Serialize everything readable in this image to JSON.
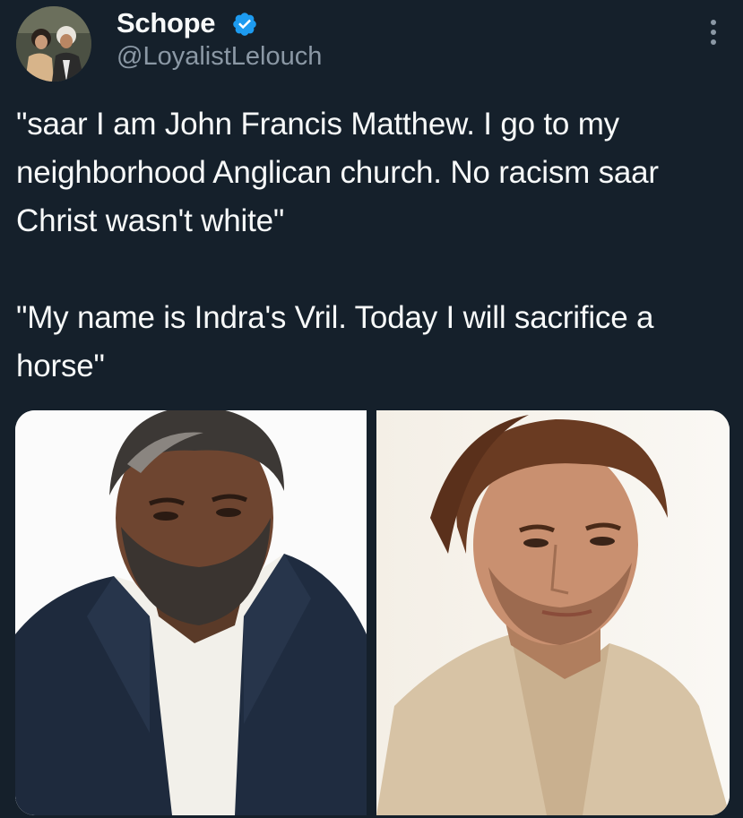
{
  "author": {
    "display_name": "Schope",
    "handle": "@LoyalistLelouch",
    "verified_icon": "verified-badge-icon",
    "avatar": "profile-avatar",
    "verified_color": "#1d9bf0"
  },
  "menu": {
    "icon": "more-options-icon"
  },
  "tweet": {
    "paragraphs": [
      "\"saar I am John Francis Matthew. I go to my neighborhood Anglican church. No racism saar Christ wasn't white\"",
      "\"My name is Indra's Vril. Today I will sacrifice a horse\""
    ]
  },
  "media": {
    "photos": [
      {
        "name": "photo-bearded-man-navy-blazer"
      },
      {
        "name": "photo-man-beige-jacket"
      }
    ]
  },
  "colors": {
    "background": "#15202b",
    "text": "#f7f9f9",
    "secondary_text": "#8b98a5"
  }
}
